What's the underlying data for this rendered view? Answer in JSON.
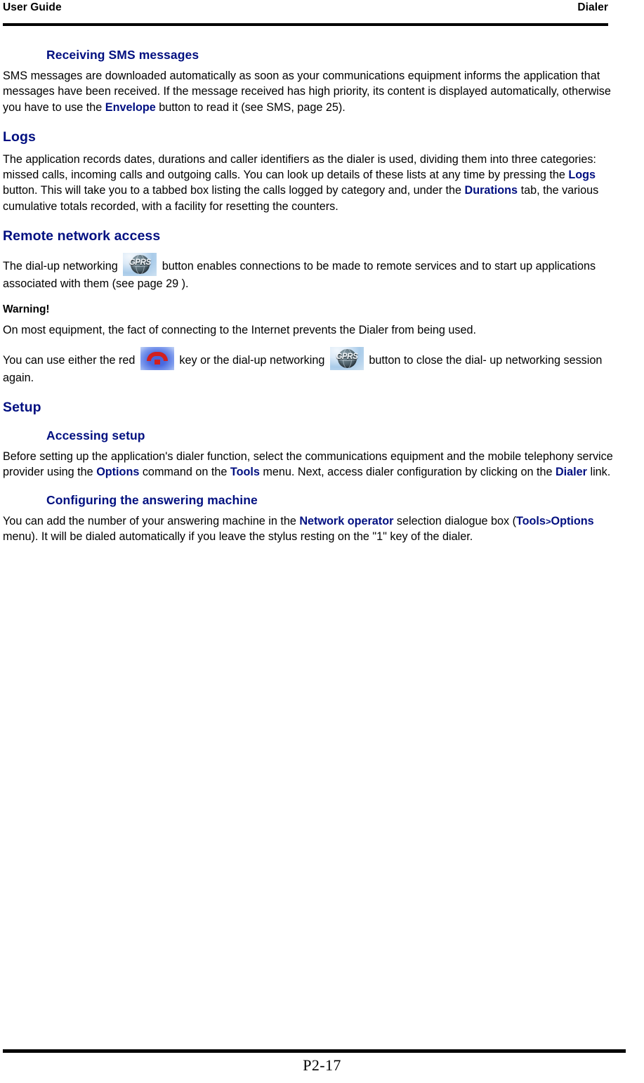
{
  "header": {
    "left": "User Guide",
    "right": "Dialer"
  },
  "sections": {
    "receiving_sms": {
      "heading": "Receiving SMS messages",
      "p1_a": "SMS messages are downloaded automatically as soon as your communications equipment informs the application that messages have been received. If the message received has high priority, its content is displayed automatically, otherwise you have to use the ",
      "p1_envelope": "Envelope",
      "p1_b": " button to read it (see SMS, page 25)."
    },
    "logs": {
      "heading": "Logs",
      "p1_a": "The application records dates, durations and caller identifiers as the dialer is used, dividing them into three categories: missed calls, incoming calls and outgoing calls. You can look up details of these lists at any time by pressing the ",
      "p1_logs": "Logs",
      "p1_b": " button. This will take you to a tabbed box listing the calls logged by category and, under the ",
      "p1_durations": "Durations",
      "p1_c": " tab, the various cumulative totals recorded, with a facility for resetting the counters."
    },
    "remote_network_access": {
      "heading": "Remote network access",
      "p1_a": "The dial-up networking ",
      "icon1": "gprs-button-icon",
      "p1_b": " button enables connections to be made to remote services and to start up applications associated with them (see page 29 ).",
      "warning_heading": "Warning!",
      "p2": "On most equipment, the fact of connecting to the Internet prevents the Dialer from being used.",
      "p3_a": "You can use either the red ",
      "icon2": "red-hangup-key-icon",
      "p3_b": " key or the dial-up networking ",
      "icon3": "gprs-button-icon",
      "p3_c": " button to close the dial- up networking session again."
    },
    "setup": {
      "heading": "Setup",
      "accessing_setup": {
        "heading": "Accessing setup",
        "p1_a": "Before setting up the application's dialer function, select the communications equipment and the mobile telephony service provider using the ",
        "p1_options": "Options",
        "p1_b": " command on the ",
        "p1_tools": "Tools",
        "p1_c": " menu. Next, access dialer configuration by clicking on the ",
        "p1_dialer": "Dialer",
        "p1_d": " link."
      },
      "answering_machine": {
        "heading": "Configuring the answering machine",
        "p1_a": "You can add the number of your answering machine in the ",
        "p1_network_operator": "Network operator",
        "p1_b": " selection dialogue box (",
        "p1_tools": "Tools",
        "p1_sep": ">",
        "p1_options": "Options",
        "p1_c": " menu). It will be dialed automatically if you leave the stylus resting on the \"1\" key of the dialer."
      }
    }
  },
  "footer": {
    "page_number": "P2-17"
  },
  "colors": {
    "heading": "#000F80",
    "text": "#000000",
    "rule": "#000000"
  },
  "icons": {
    "gprs_label": "GPRS"
  }
}
